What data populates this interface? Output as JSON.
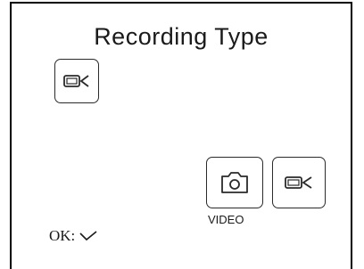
{
  "title": "Recording Type",
  "current_mode": {
    "icon": "video-camera-icon"
  },
  "options": [
    {
      "icon": "photo-camera-icon"
    },
    {
      "icon": "video-camera-icon"
    }
  ],
  "option_caption": "VIDEO",
  "footer": {
    "ok_label": "OK:",
    "ok_icon": "checkmark-icon"
  }
}
